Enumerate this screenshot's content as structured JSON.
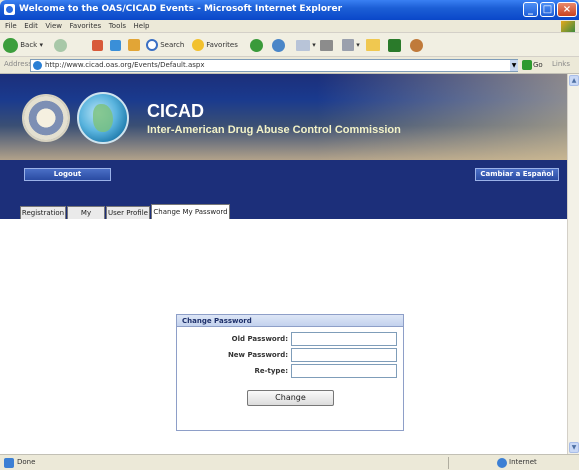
{
  "window": {
    "title": "Welcome to the OAS/CICAD Events - Microsoft Internet Explorer"
  },
  "menu": [
    "File",
    "Edit",
    "View",
    "Favorites",
    "Tools",
    "Help"
  ],
  "toolbar": {
    "back": "Back",
    "search": "Search",
    "favorites": "Favorites"
  },
  "address": {
    "label": "Address",
    "url": "http://www.cicad.oas.org/Events/Default.aspx",
    "go": "Go",
    "links": "Links"
  },
  "banner": {
    "org": "CICAD",
    "full_name": "Inter-American Drug Abuse Control Commission"
  },
  "nav": {
    "logout": "Logout",
    "language": "Cambiar a Español"
  },
  "tabs": [
    "Registration",
    "My Events",
    "User Profile",
    "Change My Password"
  ],
  "active_tab": "Change My Password",
  "panel": {
    "title": "Change Password",
    "fields": [
      {
        "label": "Old Password:",
        "value": ""
      },
      {
        "label": "New Password:",
        "value": ""
      },
      {
        "label": "Re-type:",
        "value": ""
      }
    ],
    "submit": "Change"
  },
  "status": {
    "text": "Done",
    "zone": "Internet"
  },
  "colors": {
    "titlebar": "#0a47c9",
    "banner": "#1c2f7a",
    "panel_border": "#8e9fc8"
  }
}
